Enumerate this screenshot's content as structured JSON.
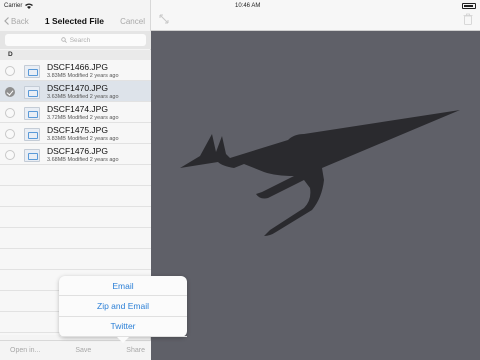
{
  "statusbar": {
    "carrier": "Carrier",
    "time": "10:46 AM"
  },
  "navbar": {
    "back_label": "Back",
    "title": "1 Selected File",
    "cancel_label": "Cancel"
  },
  "search": {
    "placeholder": "Search"
  },
  "section": {
    "header": "D"
  },
  "files": [
    {
      "name": "DSCF1466.JPG",
      "meta": "3.83MB  Modified 2 years ago",
      "selected": false
    },
    {
      "name": "DSCF1470.JPG",
      "meta": "3.63MB  Modified 2 years ago",
      "selected": true
    },
    {
      "name": "DSCF1474.JPG",
      "meta": "3.72MB  Modified 2 years ago",
      "selected": false
    },
    {
      "name": "DSCF1475.JPG",
      "meta": "3.83MB  Modified 2 years ago",
      "selected": false
    },
    {
      "name": "DSCF1476.JPG",
      "meta": "3.68MB  Modified 2 years ago",
      "selected": false
    }
  ],
  "toolbar": {
    "open_in": "Open in...",
    "save": "Save",
    "share": "Share"
  },
  "share_menu": {
    "items": [
      "Email",
      "Zip and Email",
      "Twitter"
    ]
  },
  "colors": {
    "accent": "#2b7fd6",
    "pane": "#5f6068",
    "logo": "#2a2a2e"
  }
}
